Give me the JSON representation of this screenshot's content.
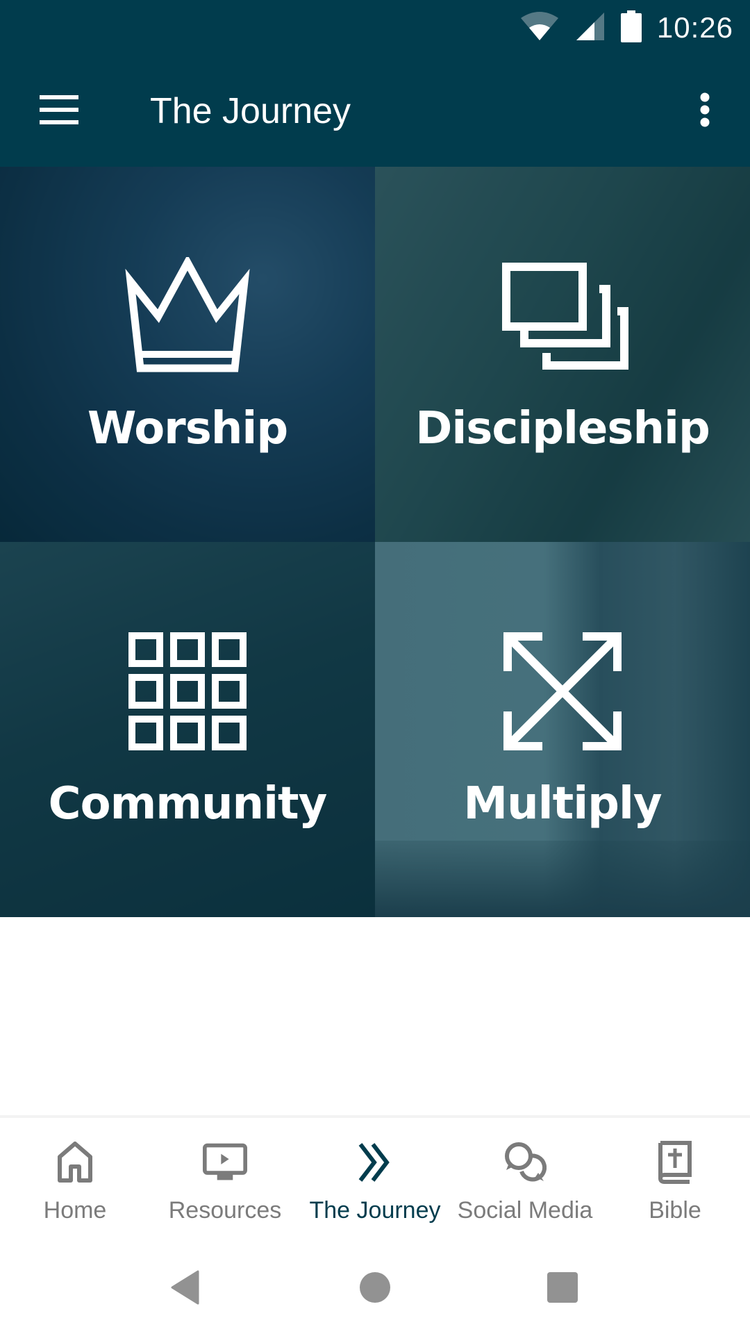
{
  "status_bar": {
    "time": "10:26",
    "icons": [
      "wifi-icon",
      "cellular-signal-icon",
      "battery-icon"
    ]
  },
  "app_bar": {
    "title": "The Journey",
    "menu_icon": "hamburger-menu-icon",
    "overflow_icon": "more-vert-icon"
  },
  "tiles": [
    {
      "label": "Worship",
      "icon": "crown-icon"
    },
    {
      "label": "Discipleship",
      "icon": "stacked-squares-icon"
    },
    {
      "label": "Community",
      "icon": "grid-icon"
    },
    {
      "label": "Multiply",
      "icon": "expand-arrows-icon"
    }
  ],
  "bottom_nav": {
    "active_index": 2,
    "items": [
      {
        "label": "Home",
        "icon": "home-icon"
      },
      {
        "label": "Resources",
        "icon": "video-screen-icon"
      },
      {
        "label": "The Journey",
        "icon": "double-chevron-icon"
      },
      {
        "label": "Social Media",
        "icon": "chat-bubbles-icon"
      },
      {
        "label": "Bible",
        "icon": "bible-icon"
      }
    ]
  },
  "system_nav": [
    "back-icon",
    "home-circle-icon",
    "recents-icon"
  ],
  "colors": {
    "primary": "#013c4d",
    "nav_inactive": "#7b7b7b",
    "system_icon": "#929292"
  }
}
